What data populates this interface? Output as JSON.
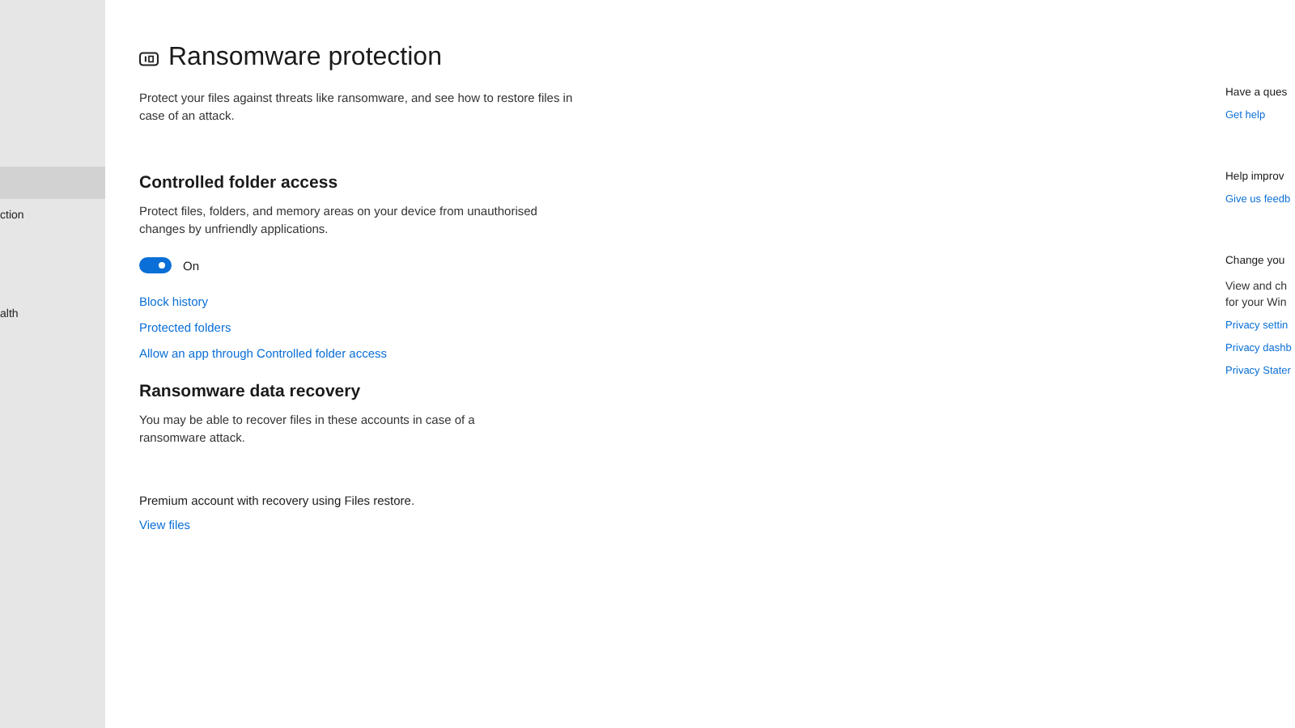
{
  "sidebar": {
    "items": [
      {
        "selected": true
      },
      {
        "label": "ction",
        "selected": false
      },
      {
        "label": "alth",
        "selected": false
      }
    ]
  },
  "page": {
    "title": "Ransomware protection",
    "description": "Protect your files against threats like ransomware, and see how to restore files in case of an attack."
  },
  "controlled_folder_access": {
    "heading": "Controlled folder access",
    "description": "Protect files, folders, and memory areas on your device from unauthorised changes by unfriendly applications.",
    "toggle": {
      "on": true,
      "label": "On"
    },
    "links": [
      "Block history",
      "Protected folders",
      "Allow an app through Controlled folder access"
    ]
  },
  "data_recovery": {
    "heading": "Ransomware data recovery",
    "description": "You may be able to recover files in these accounts in case of a ransomware attack.",
    "account_note": "Premium account with recovery using Files restore.",
    "link": "View files"
  },
  "side_panel": [
    {
      "text": "Have a ques",
      "links": [
        "Get help"
      ]
    },
    {
      "text": "Help improv",
      "links": [
        "Give us feedb"
      ]
    },
    {
      "text": "Change you",
      "detail": "View and ch for your Win",
      "links": [
        "Privacy settin",
        "Privacy dashb",
        "Privacy Stater"
      ]
    }
  ]
}
